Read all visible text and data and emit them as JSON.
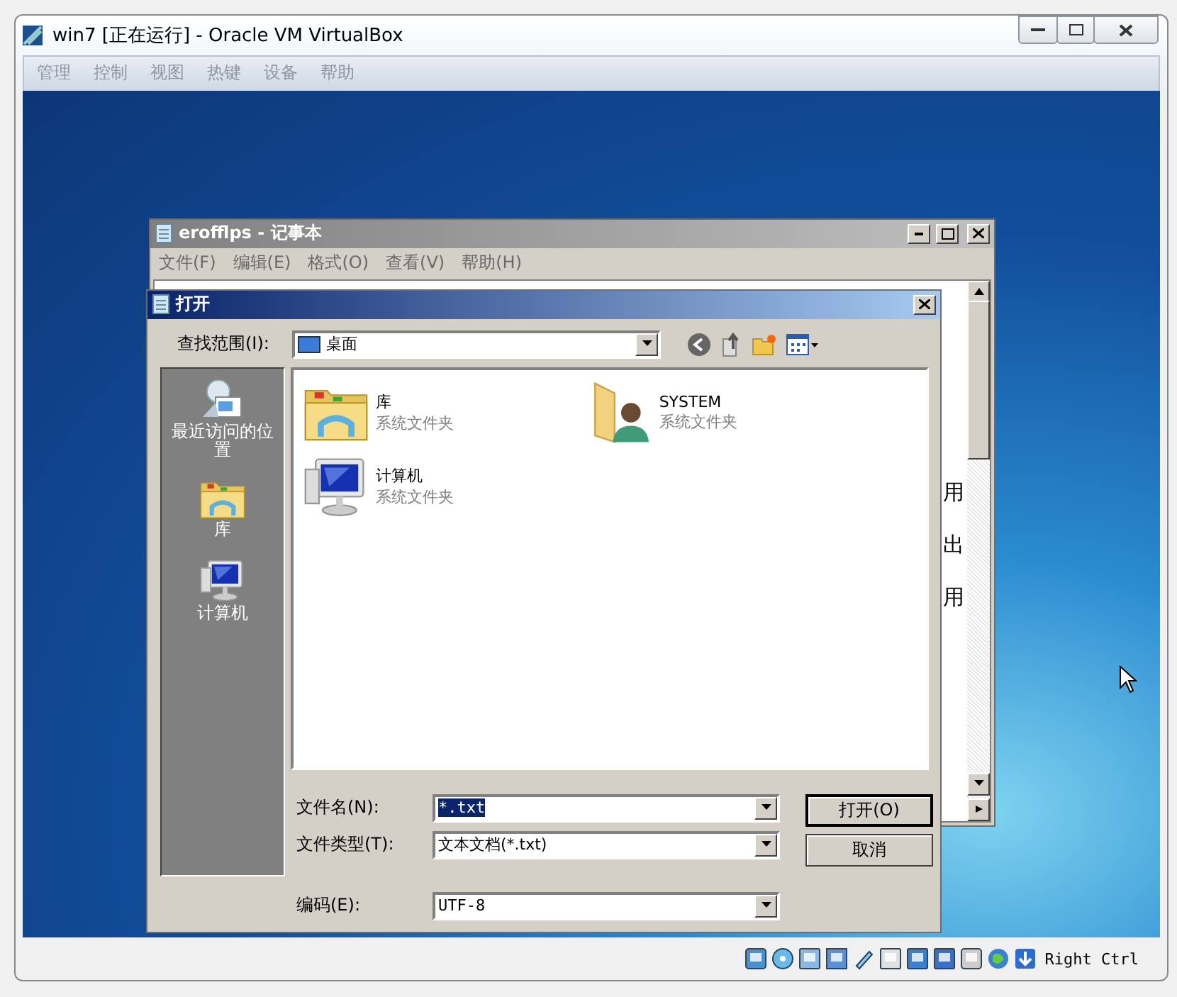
{
  "window": {
    "title": "win7 [正在运行] - Oracle VM VirtualBox"
  },
  "menu": [
    "管理",
    "控制",
    "视图",
    "热键",
    "设备",
    "帮助"
  ],
  "notepad": {
    "title": "erofflps - 记事本",
    "menu": [
      "文件(F)",
      "编辑(E)",
      "格式(O)",
      "查看(V)",
      "帮助(H)"
    ],
    "text_fragments": [
      "用",
      "出",
      "用"
    ]
  },
  "dialog": {
    "title": "打开",
    "look_in_label": "查找范围(I):",
    "look_in_value": "桌面",
    "places": [
      {
        "label": "最近访问的位置",
        "kind": "recent"
      },
      {
        "label": "库",
        "kind": "library"
      },
      {
        "label": "计算机",
        "kind": "computer"
      }
    ],
    "files": [
      {
        "name": "库",
        "type": "系统文件夹",
        "kind": "library"
      },
      {
        "name": "SYSTEM",
        "type": "系统文件夹",
        "kind": "user"
      },
      {
        "name": "计算机",
        "type": "系统文件夹",
        "kind": "computer"
      }
    ],
    "file_name_label": "文件名(N):",
    "file_name_value": "*.txt",
    "file_name_selected": true,
    "file_type_label": "文件类型(T):",
    "file_type_value": "文本文档(*.txt)",
    "encoding_label": "编码(E):",
    "encoding_value": "UTF-8",
    "buttons": [
      "打开(O)",
      "取消"
    ]
  },
  "status_bar": {
    "host_key": "Right Ctrl"
  }
}
